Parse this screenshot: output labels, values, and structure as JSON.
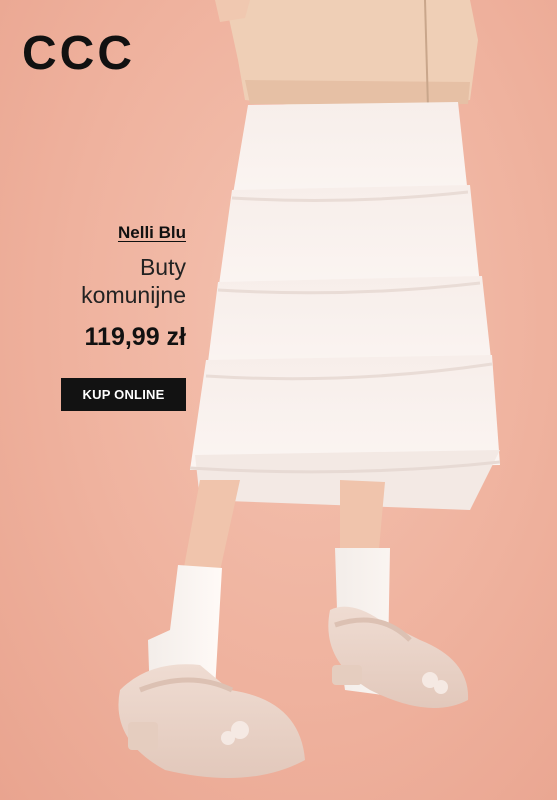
{
  "logo": {
    "text": "CCC"
  },
  "product": {
    "brand": "Nelli Blu",
    "name_line1": "Buty",
    "name_line2": "komunijne",
    "price": "119,99 zł"
  },
  "cta": {
    "label": "KUP ONLINE"
  },
  "colors": {
    "background": "#efb29e",
    "button": "#121212",
    "button_text": "#ffffff",
    "text": "#111111"
  }
}
